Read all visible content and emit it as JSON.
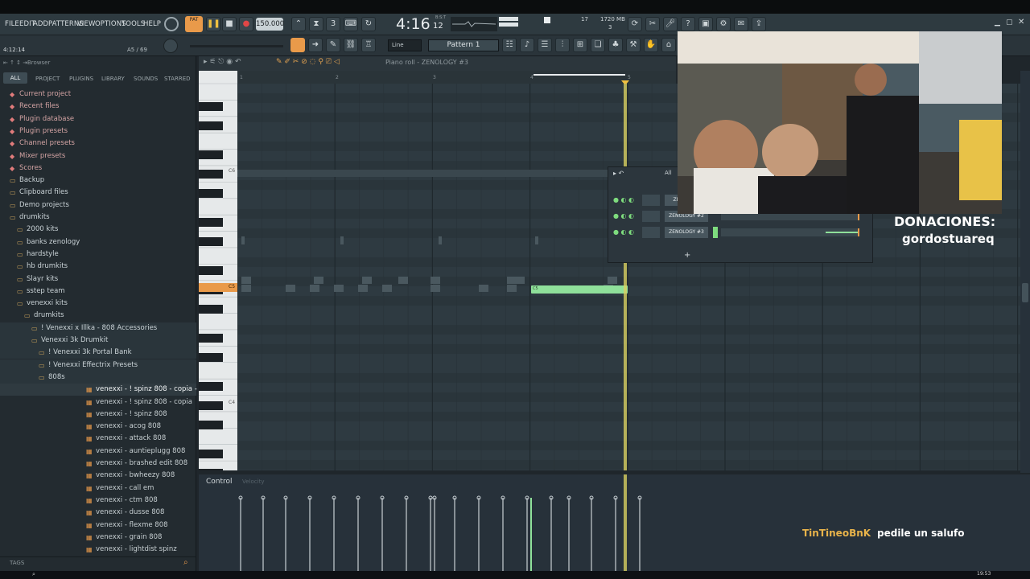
{
  "menu": [
    "FILE",
    "EDIT",
    "ADD",
    "PATTERNS",
    "VIEW",
    "OPTIONS",
    "TOOLS",
    "HELP"
  ],
  "transport": {
    "tempo": "150.000",
    "time": "4:16",
    "time_small": "12",
    "time_unit": "B:S:T",
    "cpu": "17",
    "memory": "1720 MB",
    "polyphony": "3",
    "pattern": "Pattern 1",
    "snap": "Line"
  },
  "hint_bar": {
    "position": "4:12:14",
    "counter": "A5 / 69"
  },
  "browser": {
    "title": "Browser",
    "tabs": [
      "ALL",
      "PROJECT",
      "PLUGINS",
      "LIBRARY",
      "SOUNDS",
      "STARRED"
    ],
    "tree": [
      {
        "label": "Current project",
        "indent": 0,
        "type": "special"
      },
      {
        "label": "Recent files",
        "indent": 0,
        "type": "special"
      },
      {
        "label": "Plugin database",
        "indent": 0,
        "type": "special"
      },
      {
        "label": "Plugin presets",
        "indent": 0,
        "type": "special"
      },
      {
        "label": "Channel presets",
        "indent": 0,
        "type": "special"
      },
      {
        "label": "Mixer presets",
        "indent": 0,
        "type": "special"
      },
      {
        "label": "Scores",
        "indent": 0,
        "type": "special"
      },
      {
        "label": "Backup",
        "indent": 0,
        "type": "folder"
      },
      {
        "label": "Clipboard files",
        "indent": 0,
        "type": "folder"
      },
      {
        "label": "Demo projects",
        "indent": 0,
        "type": "folder"
      },
      {
        "label": "drumkits",
        "indent": 0,
        "type": "folder-open"
      },
      {
        "label": "2000 kits",
        "indent": 1,
        "type": "folder"
      },
      {
        "label": "banks zenology",
        "indent": 1,
        "type": "folder"
      },
      {
        "label": "hardstyle",
        "indent": 1,
        "type": "folder"
      },
      {
        "label": "hb drumkits",
        "indent": 1,
        "type": "folder"
      },
      {
        "label": "Slayr kits",
        "indent": 1,
        "type": "folder"
      },
      {
        "label": "sstep team",
        "indent": 1,
        "type": "folder"
      },
      {
        "label": "venexxi kits",
        "indent": 1,
        "type": "folder-open"
      },
      {
        "label": "drumkits",
        "indent": 2,
        "type": "folder-open"
      },
      {
        "label": "! Venexxi x Illka - 808 Accessories",
        "indent": 3,
        "type": "folder"
      },
      {
        "label": "Venexxi 3k Drumkit",
        "indent": 3,
        "type": "folder-open"
      },
      {
        "label": "! Venexxi 3k Portal Bank",
        "indent": 4,
        "type": "folder"
      },
      {
        "label": "! Venexxi Effectrix Presets",
        "indent": 4,
        "type": "folder"
      },
      {
        "label": "808s",
        "indent": 4,
        "type": "folder-open"
      },
      {
        "label": "venexxi - ! spinz 808 - copia - copia",
        "indent": 5,
        "type": "file-selected"
      },
      {
        "label": "venexxi - ! spinz 808 - copia",
        "indent": 5,
        "type": "file"
      },
      {
        "label": "venexxi - ! spinz 808",
        "indent": 5,
        "type": "file"
      },
      {
        "label": "venexxi - acog 808",
        "indent": 5,
        "type": "file"
      },
      {
        "label": "venexxi - attack 808",
        "indent": 5,
        "type": "file"
      },
      {
        "label": "venexxi - auntieplugg 808",
        "indent": 5,
        "type": "file"
      },
      {
        "label": "venexxi - brashed edit 808",
        "indent": 5,
        "type": "file"
      },
      {
        "label": "venexxi - bwheezy 808",
        "indent": 5,
        "type": "file"
      },
      {
        "label": "venexxi - call em",
        "indent": 5,
        "type": "file"
      },
      {
        "label": "venexxi - ctm 808",
        "indent": 5,
        "type": "file"
      },
      {
        "label": "venexxi - dusse 808",
        "indent": 5,
        "type": "file"
      },
      {
        "label": "venexxi - flexme 808",
        "indent": 5,
        "type": "file"
      },
      {
        "label": "venexxi - grain 808",
        "indent": 5,
        "type": "file"
      },
      {
        "label": "venexxi - lightdist spinz",
        "indent": 5,
        "type": "file"
      }
    ],
    "tags_label": "TAGS"
  },
  "piano_roll": {
    "title": "Piano roll - ZENOLOGY #3",
    "bar_numbers": [
      "1",
      "2",
      "3",
      "4",
      "5"
    ],
    "key_labels": [
      "C6",
      "C5",
      "C4"
    ],
    "note_label": "C5",
    "control_label": "Control",
    "control_sub": "Velocity"
  },
  "channel_rack": {
    "filter": "All",
    "channels": [
      "ZENOLOGY",
      "ZENOLOGY #2",
      "ZENOLOGY #3"
    ],
    "add": "+"
  },
  "overlay": {
    "donations_title": "DONACIONES:",
    "donations_user": "gordostuareq",
    "chat_user": "TinTineoBnK",
    "chat_msg": "pedile un salufo"
  },
  "taskbar": {
    "clock": "19:53"
  },
  "colors": {
    "note": "#8fe09a",
    "playhead": "#d8d060",
    "accent_orange": "#e99a4a"
  }
}
